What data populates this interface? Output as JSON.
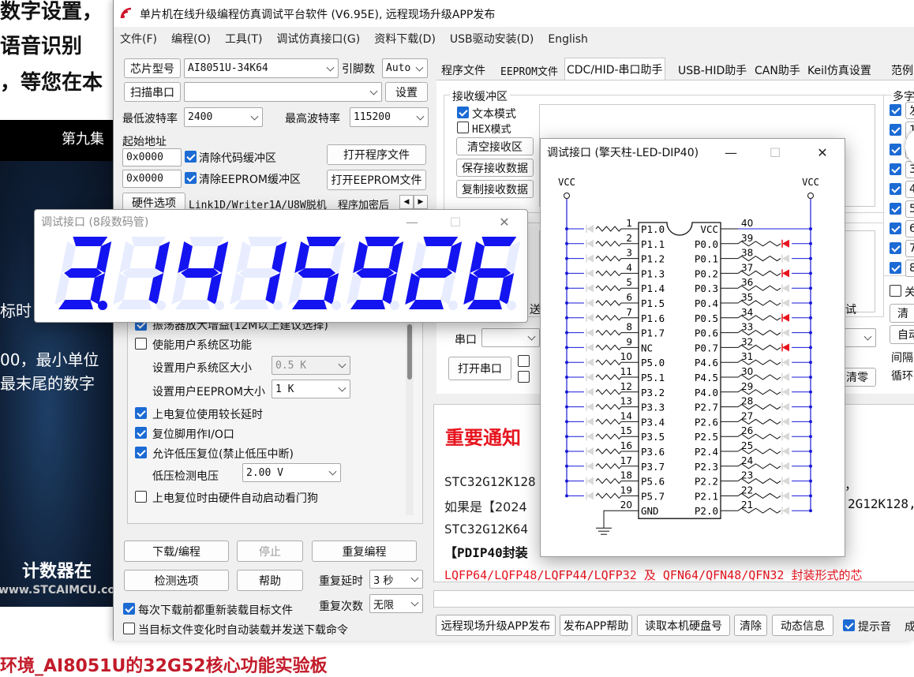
{
  "background": {
    "lines": [
      "数字设置，",
      "语音识别",
      "，等您在本"
    ],
    "episode": "第九集",
    "left_lines": [
      "标时",
      "00，最小单位",
      "最末尾的数字"
    ],
    "subtitle": "计数器在",
    "site": "www.STCAIMCU.com",
    "bottom_caption": "环境_AI8051U的32G52核心功能实验板"
  },
  "app": {
    "title": "单片机在线升级编程仿真调试平台软件 (V6.95E), 远程现场升级APP发布",
    "menu": [
      "文件(F)",
      "编程(O)",
      "工具(T)",
      "调试仿真接口(G)",
      "资料下载(D)",
      "USB驱动安装(D)",
      "English"
    ],
    "chip_label": "芯片型号",
    "chip_value": "AI8051U-34K64",
    "pin_label": "引脚数",
    "pin_value": "Auto",
    "scan_port": "扫描串口",
    "settings": "设置",
    "min_baud_label": "最低波特率",
    "min_baud": "2400",
    "max_baud_label": "最高波特率",
    "max_baud": "115200",
    "start_addr_label": "起始地址",
    "addr1": "0x0000",
    "addr2": "0x0000",
    "clear_code": "清除代码缓冲区",
    "clear_eeprom": "清除EEPROM缓冲区",
    "open_prog": "打开程序文件",
    "open_eeprom": "打开EEPROM文件",
    "hw_options": "硬件选项",
    "hw_tab2": "Link1D/Writer1A/U8W脱机",
    "hw_tab3": "程序加密后",
    "osc_gain": "振荡器放大增益(12M以上建议选择)",
    "user_sys": "使能用户系统区功能",
    "user_sys_size_label": "设置用户系统区大小",
    "user_sys_size": "0.5 K",
    "user_eeprom_label": "设置用户EEPROM大小",
    "user_eeprom": "1  K",
    "long_delay": "上电复位使用较长延时",
    "reset_io": "复位脚用作I/O口",
    "low_volt_reset": "允许低压复位(禁止低压中断)",
    "low_volt_label": "低压检测电压",
    "low_volt": "2.00 V",
    "wdt": "上电复位时由硬件自动启动看门狗",
    "download": "下载/编程",
    "stop": "停止",
    "reprog": "重复编程",
    "check_opts": "检测选项",
    "help": "帮助",
    "repeat_delay_label": "重复延时",
    "repeat_delay": "3 秒",
    "repeat_count_label": "重复次数",
    "repeat_count": "无限",
    "reload_each": "每次下载前都重新装载目标文件",
    "auto_reload": "当目标文件变化时自动装载并发送下载命令",
    "tabs": [
      "程序文件",
      "EEPROM文件",
      "CDC/HID-串口助手",
      "USB-HID助手",
      "CAN助手",
      "Keil仿真设置",
      "范例"
    ],
    "recv_buffer": "接收缓冲区",
    "text_mode": "文本模式",
    "hex_mode": "HEX模式",
    "clear_recv": "清空接收区",
    "save_recv": "保存接收数据",
    "copy_recv": "复制接收数据",
    "multi": "多字",
    "multi_items": [
      "发",
      "1",
      "2",
      "3",
      "4",
      "5",
      "6",
      "7",
      "8"
    ],
    "close_label": "关",
    "clear_r": "清",
    "auto_r": "自动",
    "interval": "间隔",
    "loop": "循环",
    "send_partial": "送",
    "test_partial": "试",
    "port_label": "串口",
    "open_port": "打开串口",
    "clear_zero": "清零",
    "notice_title": "重要通知",
    "notice_lines": [
      "STC32G12K128",
      "如果是【2024",
      "STC32G12K64",
      "【PDIP40封装",
      "LQFP64/LQFP48/LQFP44/LQFP32 及 QFN64/QFN48/QFN32 封装形式的芯"
    ],
    "notice_right1": "，",
    "notice_right2": "2G12K128,",
    "bottom_buttons": [
      "远程现场升级APP发布",
      "发布APP帮助",
      "读取本机硬盘号",
      "清除",
      "动态信息"
    ],
    "beep": "提示音",
    "cut_char": "成"
  },
  "seg_window": {
    "title": "调试接口 (8段数码管)",
    "digits": [
      "3",
      "1",
      "4",
      "1",
      "5",
      "9",
      "2",
      "6"
    ],
    "decimal_after": 0,
    "digit_color": "#1414f0",
    "ghost_color": "#e8ecff"
  },
  "led_window": {
    "title": "调试接口 (擎天柱-LED-DIP40)",
    "vcc": "VCC",
    "vcc40": "VCC",
    "gnd": "GND",
    "left_pins": [
      "P1.0",
      "P1.1",
      "P1.2",
      "P1.3",
      "P1.4",
      "P1.5",
      "P1.6",
      "P1.7",
      "NC",
      "P5.0",
      "P5.1",
      "P3.2",
      "P3.3",
      "P3.4",
      "P3.5",
      "P3.6",
      "P3.7",
      "P5.6",
      "P5.7",
      "GND"
    ],
    "right_pins": [
      "VCC",
      "P0.0",
      "P0.1",
      "P0.2",
      "P0.3",
      "P0.4",
      "P0.5",
      "P0.6",
      "P0.7",
      "P4.6",
      "P4.5",
      "P4.0",
      "P2.7",
      "P2.6",
      "P2.5",
      "P2.4",
      "P2.3",
      "P2.2",
      "P2.1",
      "P2.0"
    ],
    "right_lit": [
      false,
      true,
      false,
      true,
      false,
      false,
      true,
      false,
      true,
      false,
      false,
      false,
      false,
      false,
      false,
      false,
      false,
      false,
      false,
      false
    ],
    "led_on": "#e8141e",
    "led_off": "#d8d8d8",
    "wire_color": "#1a1ad8"
  }
}
